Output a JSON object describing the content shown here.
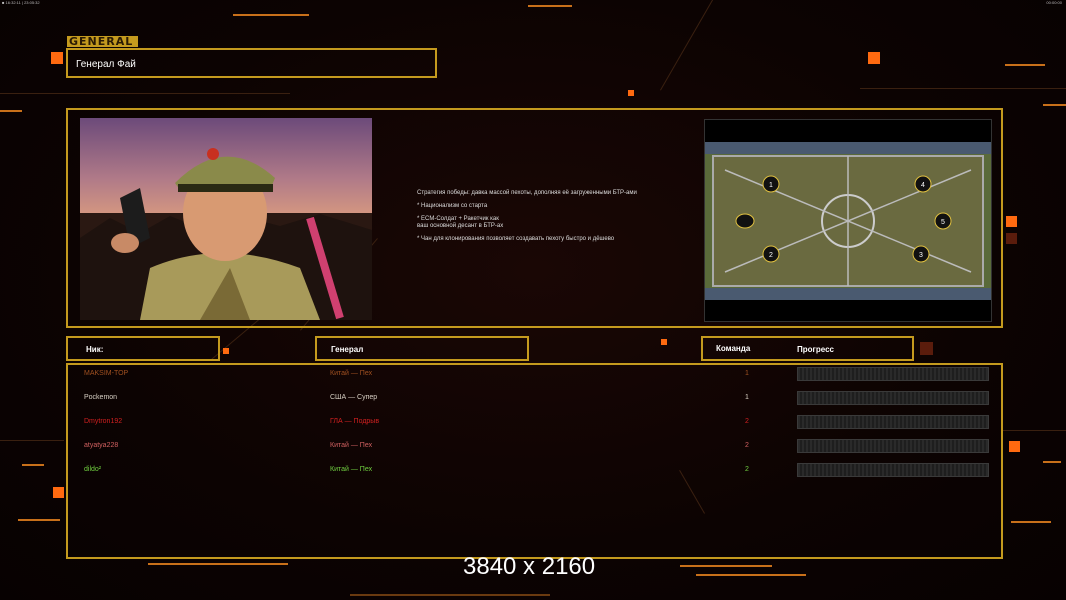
{
  "topbar": {
    "left": "■ 16:32:11 | 23:05:32",
    "right": "00:00:00"
  },
  "header": {
    "tag": "GENERAL",
    "general_name": "Генерал Фай"
  },
  "description": {
    "line1": "Стратегия победы: давка массой пехоты, дополняя её загруженными БТР-ами",
    "line2": "* Национализм со старта",
    "line3": "* ECM-Солдат + Ракетчик как",
    "line3b": "ваш основной десант в БТР-ах",
    "line4": "* Чан для клонирования позволяет создавать пехоту быстро и дёшево"
  },
  "map": {
    "slots": [
      "1",
      "2",
      "3",
      "4",
      "5"
    ]
  },
  "columns": {
    "nick": "Ник:",
    "general": "Генерал",
    "team": "Команда",
    "progress": "Прогресс"
  },
  "players": [
    {
      "nick": "MAKSIM-TOP",
      "general": "Китай — Пех",
      "team": "1",
      "color": "#a05020",
      "progress": 0
    },
    {
      "nick": "Pockemon",
      "general": "США — Супер",
      "team": "1",
      "color": "#d8d0c4",
      "progress": 0
    },
    {
      "nick": "Dmytron192",
      "general": "ГЛА — Подрыв",
      "team": "2",
      "color": "#d02020",
      "progress": 0
    },
    {
      "nick": "atyatya228",
      "general": "Китай — Пех",
      "team": "2",
      "color": "#d06060",
      "progress": 0
    },
    {
      "nick": "dildo²",
      "general": "Китай — Пех",
      "team": "2",
      "color": "#70d040",
      "progress": 0
    }
  ],
  "resolution": "3840 x 2160",
  "colors": {
    "frame": "#c49a1e",
    "accent": "#ff6a10"
  }
}
